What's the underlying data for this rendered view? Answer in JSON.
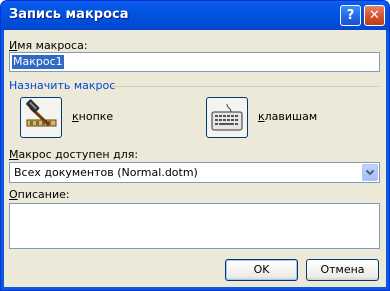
{
  "window": {
    "title": "Запись макроса",
    "help_button": "?",
    "close_button": "✕"
  },
  "macro_name": {
    "label_prefix": "",
    "label_hotkey": "И",
    "label_rest": "мя макроса:",
    "value": "Макрос1"
  },
  "assign": {
    "group_title": "Назначить макрос",
    "button_prefix": "",
    "button_hotkey": "к",
    "button_rest": "нопке",
    "keyboard_prefix": "",
    "keyboard_hotkey": "к",
    "keyboard_rest": "лавишам"
  },
  "store_in": {
    "label_prefix": "",
    "label_hotkey": "М",
    "label_rest": "акрос доступен для:",
    "value": "Всех документов (Normal.dotm)"
  },
  "description": {
    "label_prefix": "",
    "label_hotkey": "О",
    "label_rest": "писание:",
    "value": ""
  },
  "buttons": {
    "ok": "OK",
    "cancel": "Отмена"
  },
  "colors": {
    "title_bar": "#0053e0",
    "dialog_bg": "#ece9d8",
    "group_title": "#0046d5",
    "selection": "#316ac5"
  }
}
